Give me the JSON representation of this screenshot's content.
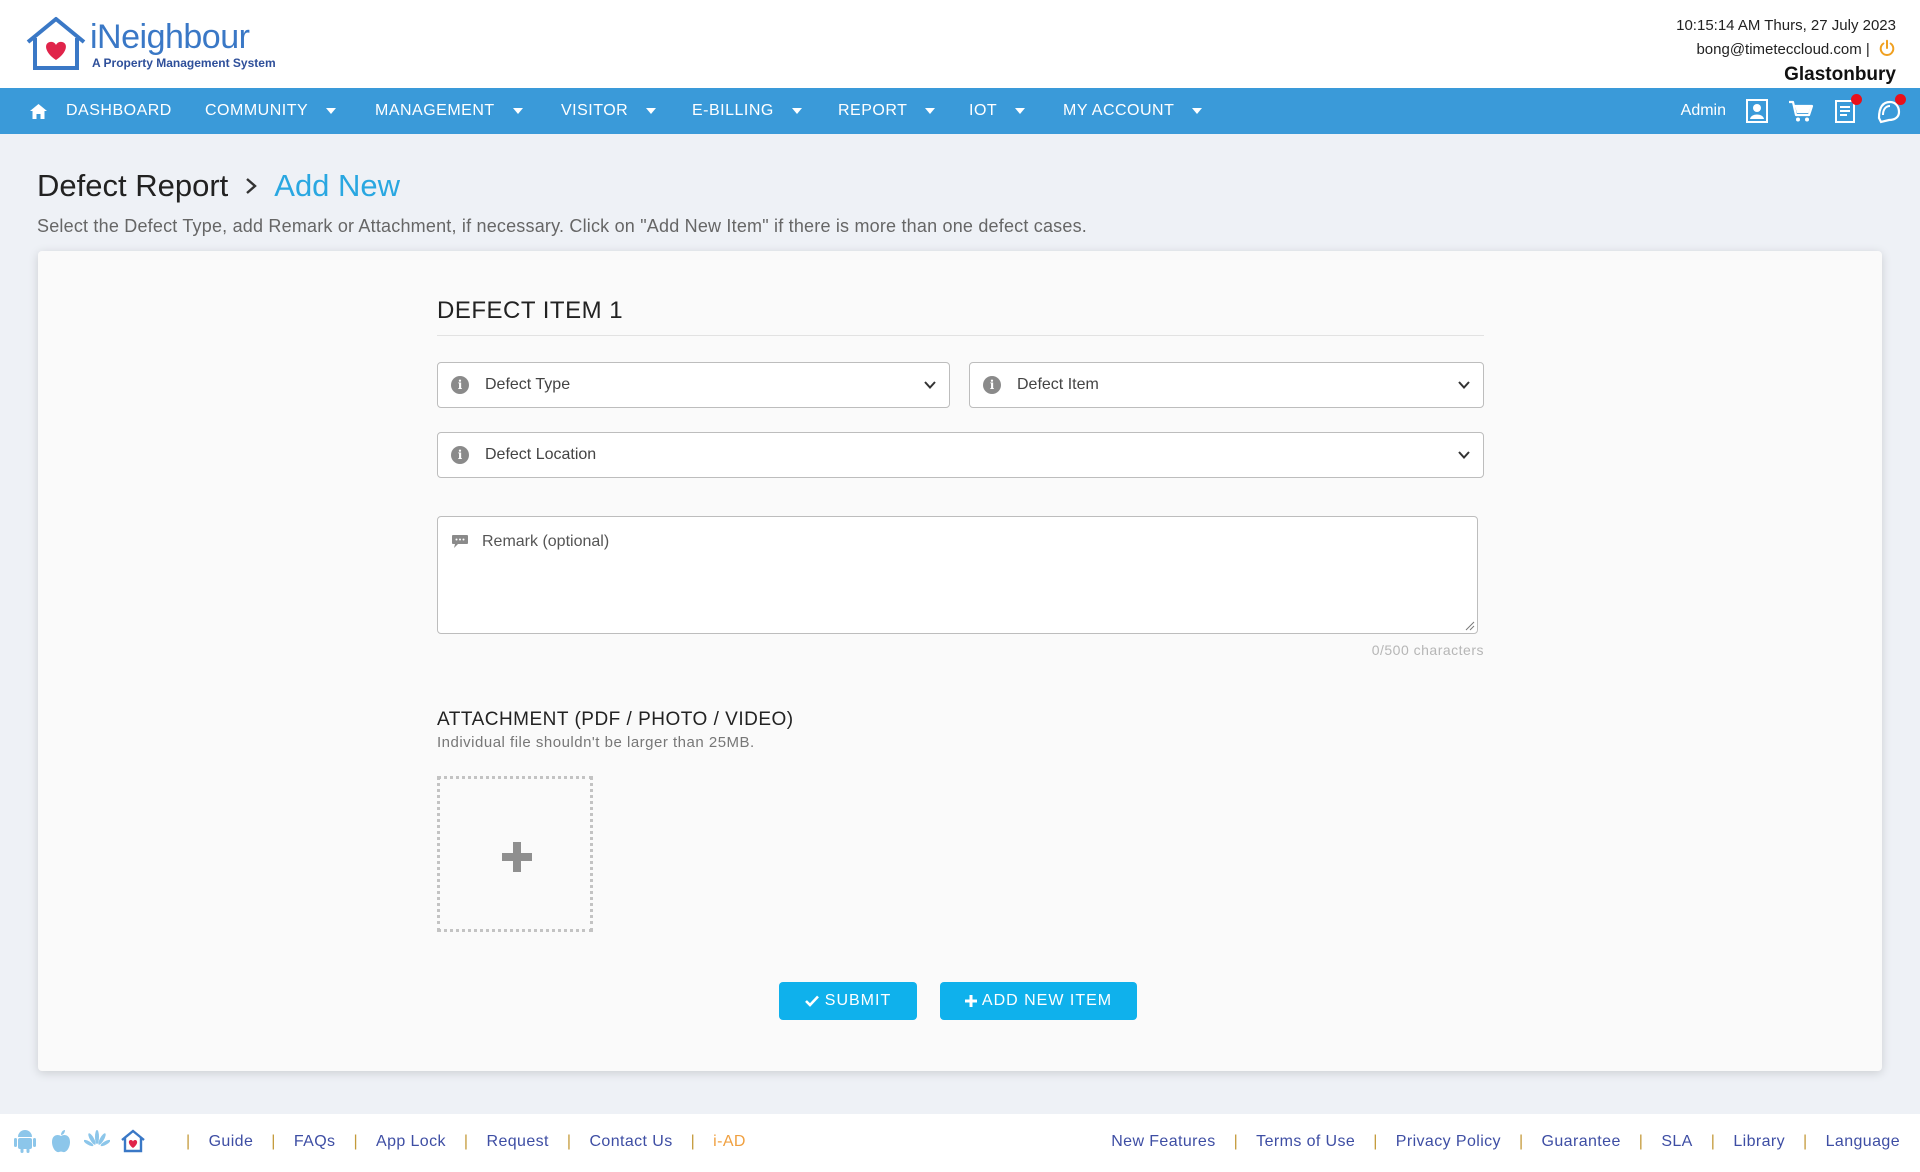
{
  "brand": {
    "name": "iNeighbour",
    "tagline": "A Property Management System"
  },
  "header": {
    "datetime": "10:15:14 AM  Thurs, 27 July 2023",
    "email": "bong@timeteccloud.com |",
    "site": "Glastonbury"
  },
  "nav": {
    "items": [
      {
        "label": "DASHBOARD"
      },
      {
        "label": "COMMUNITY"
      },
      {
        "label": "MANAGEMENT"
      },
      {
        "label": "VISITOR"
      },
      {
        "label": "E-BILLING"
      },
      {
        "label": "REPORT"
      },
      {
        "label": "IOT"
      },
      {
        "label": "MY ACCOUNT"
      }
    ],
    "user": "Admin",
    "icons": [
      "profile-icon",
      "cart-icon",
      "notes-icon",
      "notification-icon"
    ]
  },
  "page": {
    "breadcrumb_root": "Defect Report",
    "breadcrumb_current": "Add New",
    "instructions": "Select the Defect Type, add Remark or Attachment, if necessary. Click on \"Add New Item\" if there is more than one defect cases."
  },
  "form": {
    "item_title": "DEFECT ITEM 1",
    "defect_type": "Defect Type",
    "defect_item": "Defect Item",
    "defect_location": "Defect Location",
    "remark_placeholder": "Remark (optional)",
    "char_counter": "0/500 characters",
    "attachment_title": "ATTACHMENT (PDF / PHOTO / VIDEO)",
    "attachment_note": "Individual file shouldn't be larger than 25MB.",
    "submit_label": "SUBMIT",
    "add_item_label": "ADD NEW ITEM"
  },
  "footer": {
    "left_links": [
      "Guide",
      "FAQs",
      "App Lock",
      "Request",
      "Contact Us",
      "i-AD"
    ],
    "right_links": [
      "New Features",
      "Terms of Use",
      "Privacy Policy",
      "Guarantee",
      "SLA",
      "Library",
      "Language"
    ],
    "app_icons": [
      "android-icon",
      "apple-icon",
      "huawei-icon",
      "ineighbour-app-icon"
    ]
  },
  "colors": {
    "nav": "#3a9ad9",
    "accent": "#29a7e1",
    "button": "#0fb1ec",
    "badge": "#e8101a",
    "footer_link": "#3e4ea4",
    "iad_link": "#f0a040"
  }
}
